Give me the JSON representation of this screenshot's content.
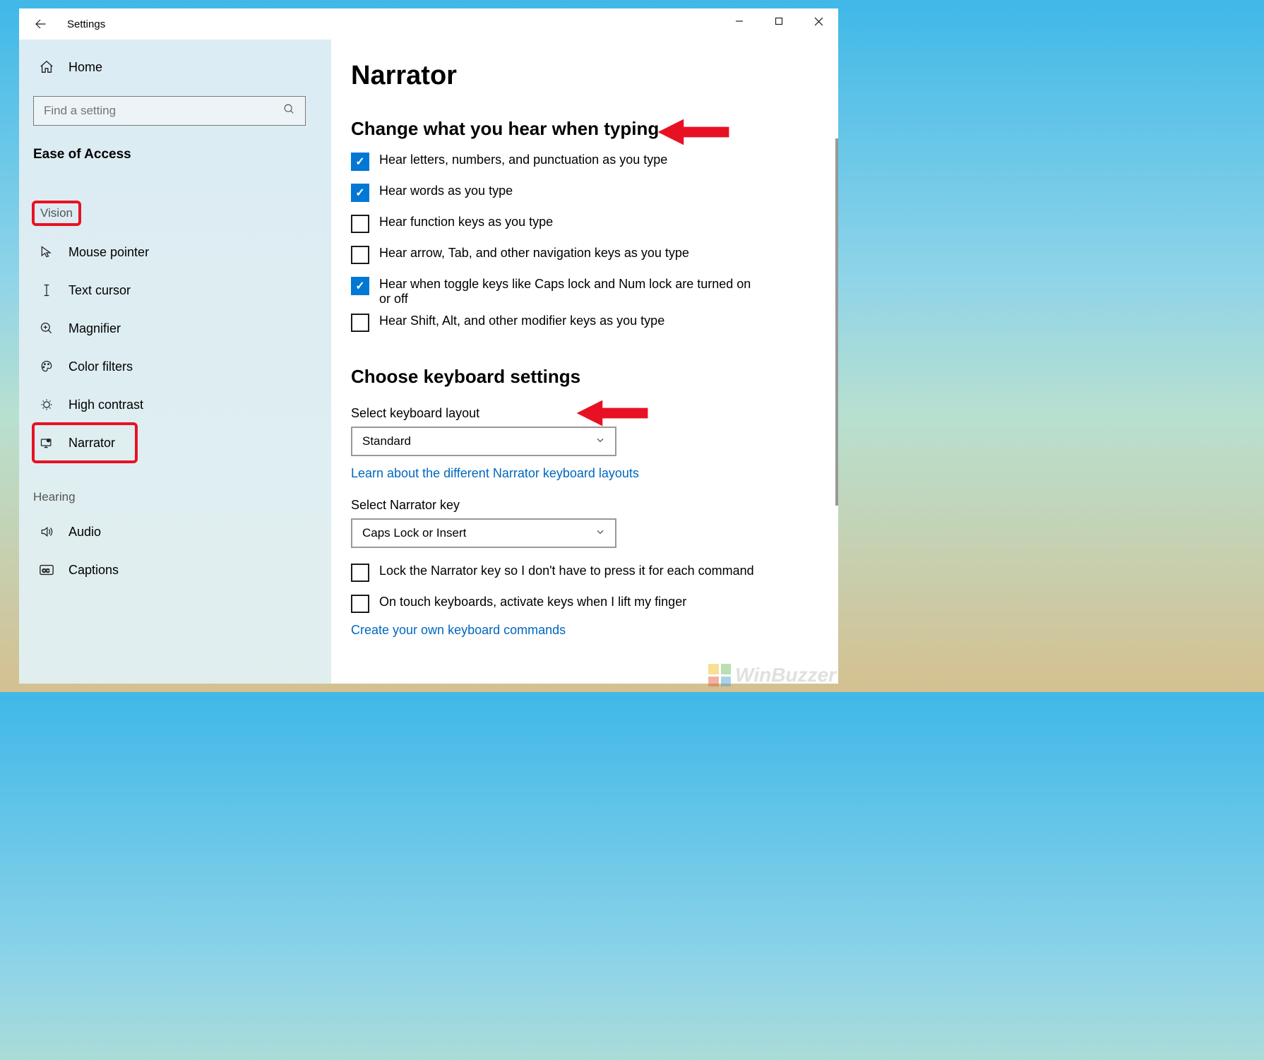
{
  "window": {
    "title": "Settings"
  },
  "sidebar": {
    "home": "Home",
    "search_placeholder": "Find a setting",
    "category": "Ease of Access",
    "groups": [
      {
        "label": "Vision",
        "items": [
          {
            "icon": "mouse-pointer-icon",
            "label": "Mouse pointer"
          },
          {
            "icon": "text-cursor-icon",
            "label": "Text cursor"
          },
          {
            "icon": "magnifier-icon",
            "label": "Magnifier"
          },
          {
            "icon": "color-filters-icon",
            "label": "Color filters"
          },
          {
            "icon": "high-contrast-icon",
            "label": "High contrast"
          },
          {
            "icon": "narrator-icon",
            "label": "Narrator"
          }
        ]
      },
      {
        "label": "Hearing",
        "items": [
          {
            "icon": "audio-icon",
            "label": "Audio"
          },
          {
            "icon": "captions-icon",
            "label": "Captions"
          }
        ]
      }
    ]
  },
  "content": {
    "page_title": "Narrator",
    "section1": {
      "title": "Change what you hear when typing",
      "checks": [
        {
          "label": "Hear letters, numbers, and punctuation as you type",
          "checked": true
        },
        {
          "label": "Hear words as you type",
          "checked": true
        },
        {
          "label": "Hear function keys as you type",
          "checked": false
        },
        {
          "label": "Hear arrow, Tab, and other navigation keys as you type",
          "checked": false
        },
        {
          "label": "Hear when toggle keys like Caps lock and Num lock are turned on or off",
          "checked": true
        },
        {
          "label": "Hear Shift, Alt, and other modifier keys as you type",
          "checked": false
        }
      ]
    },
    "section2": {
      "title": "Choose keyboard settings",
      "layout_label": "Select keyboard layout",
      "layout_value": "Standard",
      "layout_link": "Learn about the different Narrator keyboard layouts",
      "narrator_key_label": "Select Narrator key",
      "narrator_key_value": "Caps Lock or Insert",
      "checks": [
        {
          "label": "Lock the Narrator key so I don't have to press it for each command",
          "checked": false
        },
        {
          "label": "On touch keyboards, activate keys when I lift my finger",
          "checked": false
        }
      ],
      "commands_link": "Create your own keyboard commands"
    }
  },
  "watermark": "WinBuzzer"
}
